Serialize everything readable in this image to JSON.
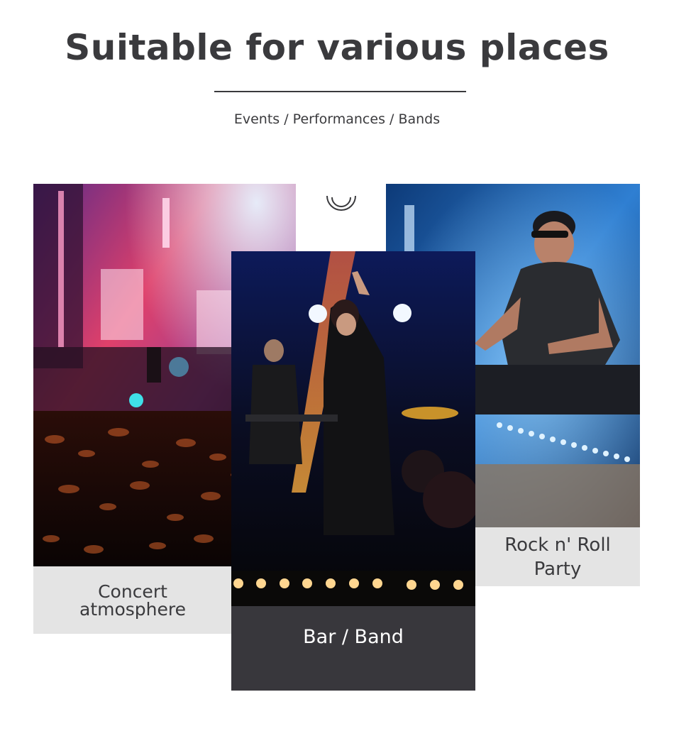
{
  "header": {
    "title": "Suitable for various places",
    "subtitle": "Events / Performances / Bands"
  },
  "decor_icon": "arc-icon",
  "cards": [
    {
      "caption_line1": "Concert",
      "caption_line2": "atmosphere",
      "photo": "concert-crowd-stage-photo"
    },
    {
      "caption": "Bar / Band",
      "photo": "singer-band-stage-photo"
    },
    {
      "caption_line1": "Rock n' Roll",
      "caption_line2": "Party",
      "photo": "dj-mixing-photo"
    }
  ],
  "colors": {
    "text_dark": "#3a3a3d",
    "caption_light_bg": "#e4e4e4",
    "caption_dark_bg": "#38373c"
  }
}
